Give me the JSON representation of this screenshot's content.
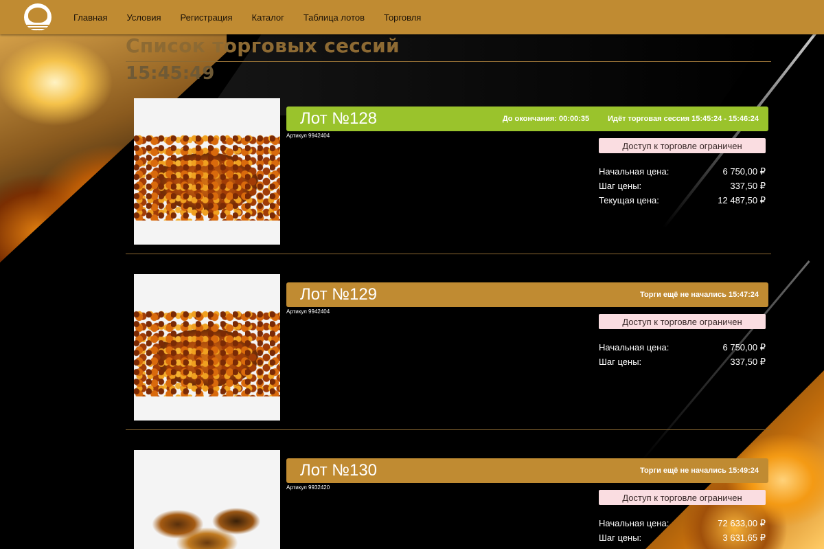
{
  "nav": {
    "items": [
      "Главная",
      "Условия",
      "Регистрация",
      "Каталог",
      "Таблица лотов",
      "Торговля"
    ]
  },
  "header": {
    "title": "Список торговых сессий",
    "clock": "15:45:49"
  },
  "colors": {
    "navbar": "#c08b32",
    "active_lot": "#9ac32c",
    "pending_lot": "#c08b32",
    "access_button": "#fadde1"
  },
  "lots": [
    {
      "name": "Лот №128",
      "sku": "Артикул 9942404",
      "countdown": "До окончания: 00:00:35",
      "status": "Идёт торговая сессия 15:45:24 - 15:46:24",
      "state": "active",
      "access_label": "Доступ к торговле ограничен",
      "prices": [
        {
          "label": "Начальная цена:",
          "value": "6 750,00 ₽"
        },
        {
          "label": "Шаг цены:",
          "value": "337,50 ₽"
        },
        {
          "label": "Текущая цена:",
          "value": "12 487,50 ₽"
        }
      ]
    },
    {
      "name": "Лот №129",
      "sku": "Артикул 9942404",
      "status": "Торги ещё не начались 15:47:24",
      "state": "pending",
      "access_label": "Доступ к торговле ограничен",
      "prices": [
        {
          "label": "Начальная цена:",
          "value": "6 750,00 ₽"
        },
        {
          "label": "Шаг цены:",
          "value": "337,50 ₽"
        }
      ]
    },
    {
      "name": "Лот №130",
      "sku": "Артикул 9932420",
      "status": "Торги ещё не начались 15:49:24",
      "state": "pending",
      "access_label": "Доступ к торговле ограничен",
      "prices": [
        {
          "label": "Начальная цена:",
          "value": "72 633,00 ₽"
        },
        {
          "label": "Шаг цены:",
          "value": "3 631,65 ₽"
        }
      ]
    }
  ]
}
